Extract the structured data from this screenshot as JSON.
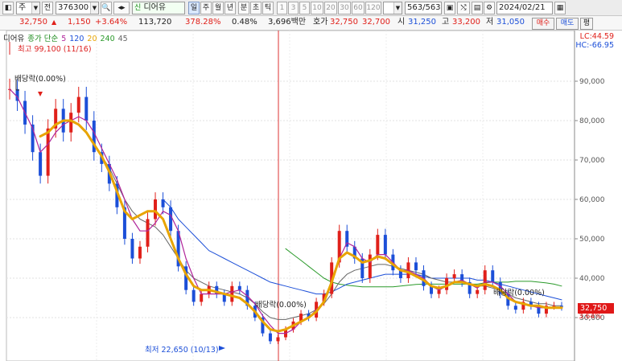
{
  "toolbar": {
    "mode_item": "주",
    "mode_all": "전",
    "code": "376300",
    "stock_name": "디어유",
    "period_buttons": [
      "일",
      "주",
      "월",
      "년",
      "분",
      "초",
      "틱"
    ],
    "interval_buttons": [
      "1",
      "3",
      "5",
      "10",
      "20",
      "30",
      "60",
      "120"
    ],
    "count": "563/563",
    "date": "2024/02/21",
    "active_period": "일"
  },
  "quote": {
    "price": "32,750",
    "change": "1,150",
    "change_pct": "+3.64%",
    "volume": "113,720",
    "volume_ratio": "378.28%",
    "turnover": "0.48%",
    "amount": "3,696백만",
    "ask_label": "호가",
    "ask1": "32,750",
    "ask2": "32,700",
    "open_label": "시",
    "open": "31,250",
    "high_label": "고",
    "high": "33,200",
    "low_label": "저",
    "low": "31,050",
    "buy_label": "매수",
    "sell_label": "매도",
    "flat_label": "평"
  },
  "legend": {
    "name": "디어유",
    "ma_label": "종가 단순",
    "ma_periods": [
      {
        "label": "5",
        "color": "#b0249a"
      },
      {
        "label": "120",
        "color": "#1c4fd8"
      },
      {
        "label": "20",
        "color": "#e8a400"
      },
      {
        "label": "240",
        "color": "#2a9a2a"
      },
      {
        "label": "45",
        "color": "#666666"
      }
    ],
    "high_note": "최고 99,100 (11/16)",
    "low_note": "최저 22,650 (10/13)",
    "lc": "LC:44.59",
    "hc": "HC:-66.95"
  },
  "annotations": {
    "dividend1": "배당락(0.00%)",
    "dividend2": "배당락(0.00%)",
    "dividend3": "배당락(0.00%)"
  },
  "price_tag": "32,750",
  "pct_tag": "3.64%",
  "chart_data": {
    "type": "line",
    "y_ticks": [
      "90,000",
      "80,000",
      "70,000",
      "60,000",
      "50,000",
      "40,000",
      "30,000"
    ],
    "ylim": [
      20000,
      100000
    ],
    "close": [
      88000,
      85000,
      79000,
      72000,
      66000,
      78000,
      83000,
      77000,
      82000,
      86000,
      80000,
      72000,
      69000,
      64000,
      58000,
      50000,
      45000,
      48000,
      55000,
      60000,
      58000,
      52000,
      43000,
      37000,
      34000,
      36000,
      38000,
      36000,
      34000,
      38000,
      37000,
      33000,
      30000,
      26000,
      24000,
      25000,
      27000,
      29000,
      31000,
      30000,
      34000,
      36000,
      44000,
      52000,
      48000,
      45000,
      40000,
      46000,
      51000,
      46000,
      42000,
      40000,
      44000,
      42000,
      38000,
      36000,
      37000,
      40000,
      41000,
      39000,
      36000,
      37000,
      42000,
      39000,
      36000,
      33000,
      32000,
      34000,
      33000,
      31000,
      33000,
      33000,
      32750
    ],
    "ma5": [
      88000,
      86000,
      82000,
      78000,
      72000,
      74000,
      77000,
      79000,
      80000,
      81000,
      80000,
      77000,
      73000,
      69000,
      65000,
      60000,
      55000,
      52000,
      52000,
      54000,
      57000,
      56000,
      52000,
      45000,
      40000,
      36000,
      36000,
      36000,
      36000,
      36500,
      37000,
      35500,
      33500,
      30500,
      28000,
      26000,
      26000,
      27000,
      29000,
      30000,
      32000,
      34000,
      39000,
      45000,
      49000,
      48000,
      45000,
      44000,
      46000,
      46000,
      44000,
      42000,
      42000,
      41000,
      40000,
      38000,
      37000,
      38000,
      39000,
      39500,
      38500,
      37500,
      39000,
      39000,
      38000,
      36000,
      34000,
      33500,
      33000,
      32500,
      32500,
      32500,
      32500
    ],
    "ma20": [
      null,
      null,
      null,
      null,
      76000,
      77000,
      79000,
      80000,
      80000,
      79000,
      77000,
      74000,
      71000,
      67000,
      62000,
      57000,
      55000,
      56000,
      57000,
      57000,
      55000,
      50000,
      45000,
      41000,
      38000,
      37000,
      37000,
      36500,
      36000,
      35500,
      35000,
      33500,
      31500,
      29000,
      27000,
      26500,
      27000,
      28000,
      29000,
      30000,
      31500,
      34000,
      39000,
      45000,
      46500,
      45500,
      44000,
      44500,
      45500,
      45000,
      43500,
      42000,
      41500,
      40500,
      39500,
      38000,
      37500,
      38000,
      39000,
      39000,
      38500,
      38000,
      38500,
      38000,
      37000,
      35000,
      34000,
      33500,
      33000,
      33000,
      32500,
      32500,
      32500
    ],
    "ma45": [
      null,
      null,
      null,
      null,
      null,
      null,
      null,
      null,
      null,
      79000,
      77000,
      74000,
      71000,
      68000,
      64000,
      60000,
      57000,
      55000,
      54000,
      53000,
      51000,
      48000,
      45000,
      42000,
      40000,
      39000,
      38000,
      37500,
      37000,
      36500,
      36000,
      35000,
      33500,
      31500,
      30000,
      29500,
      29500,
      30000,
      30500,
      31000,
      32000,
      33500,
      36000,
      39000,
      41000,
      42000,
      42500,
      43000,
      43500,
      43500,
      43000,
      42500,
      42000,
      41500,
      41000,
      40000,
      39500,
      39000,
      39000,
      39000,
      38500,
      38000,
      38000,
      37500,
      37000,
      36000,
      35000,
      34500,
      34000,
      33500,
      33500,
      33000,
      33000
    ],
    "ma120": [
      null,
      null,
      null,
      null,
      null,
      null,
      null,
      null,
      null,
      null,
      null,
      null,
      null,
      null,
      null,
      null,
      null,
      null,
      null,
      null,
      60000,
      58000,
      55000,
      53000,
      51000,
      49000,
      47000,
      46000,
      45000,
      44000,
      43000,
      42000,
      41000,
      40000,
      39000,
      38500,
      38000,
      37500,
      37000,
      36500,
      36000,
      36000,
      36500,
      37500,
      38500,
      39000,
      39500,
      40000,
      40500,
      41000,
      41000,
      41000,
      41000,
      41000,
      40500,
      40000,
      40000,
      40000,
      40000,
      40000,
      40000,
      39500,
      39500,
      39000,
      38500,
      38000,
      37500,
      37000,
      36500,
      36000,
      35500,
      35000,
      34500
    ],
    "ma240": [
      null,
      null,
      null,
      null,
      null,
      null,
      null,
      null,
      null,
      null,
      null,
      null,
      null,
      null,
      null,
      null,
      null,
      null,
      null,
      null,
      null,
      null,
      null,
      null,
      null,
      null,
      null,
      null,
      null,
      null,
      null,
      null,
      null,
      null,
      null,
      null,
      47500,
      46000,
      44500,
      43000,
      41500,
      40000,
      39000,
      38500,
      38200,
      38000,
      37800,
      37800,
      37800,
      37800,
      37800,
      38000,
      38200,
      38400,
      38500,
      38500,
      38500,
      38500,
      38500,
      38500,
      38500,
      38500,
      38800,
      39000,
      39000,
      39000,
      39200,
      39200,
      39200,
      39000,
      38800,
      38500,
      38000
    ]
  }
}
